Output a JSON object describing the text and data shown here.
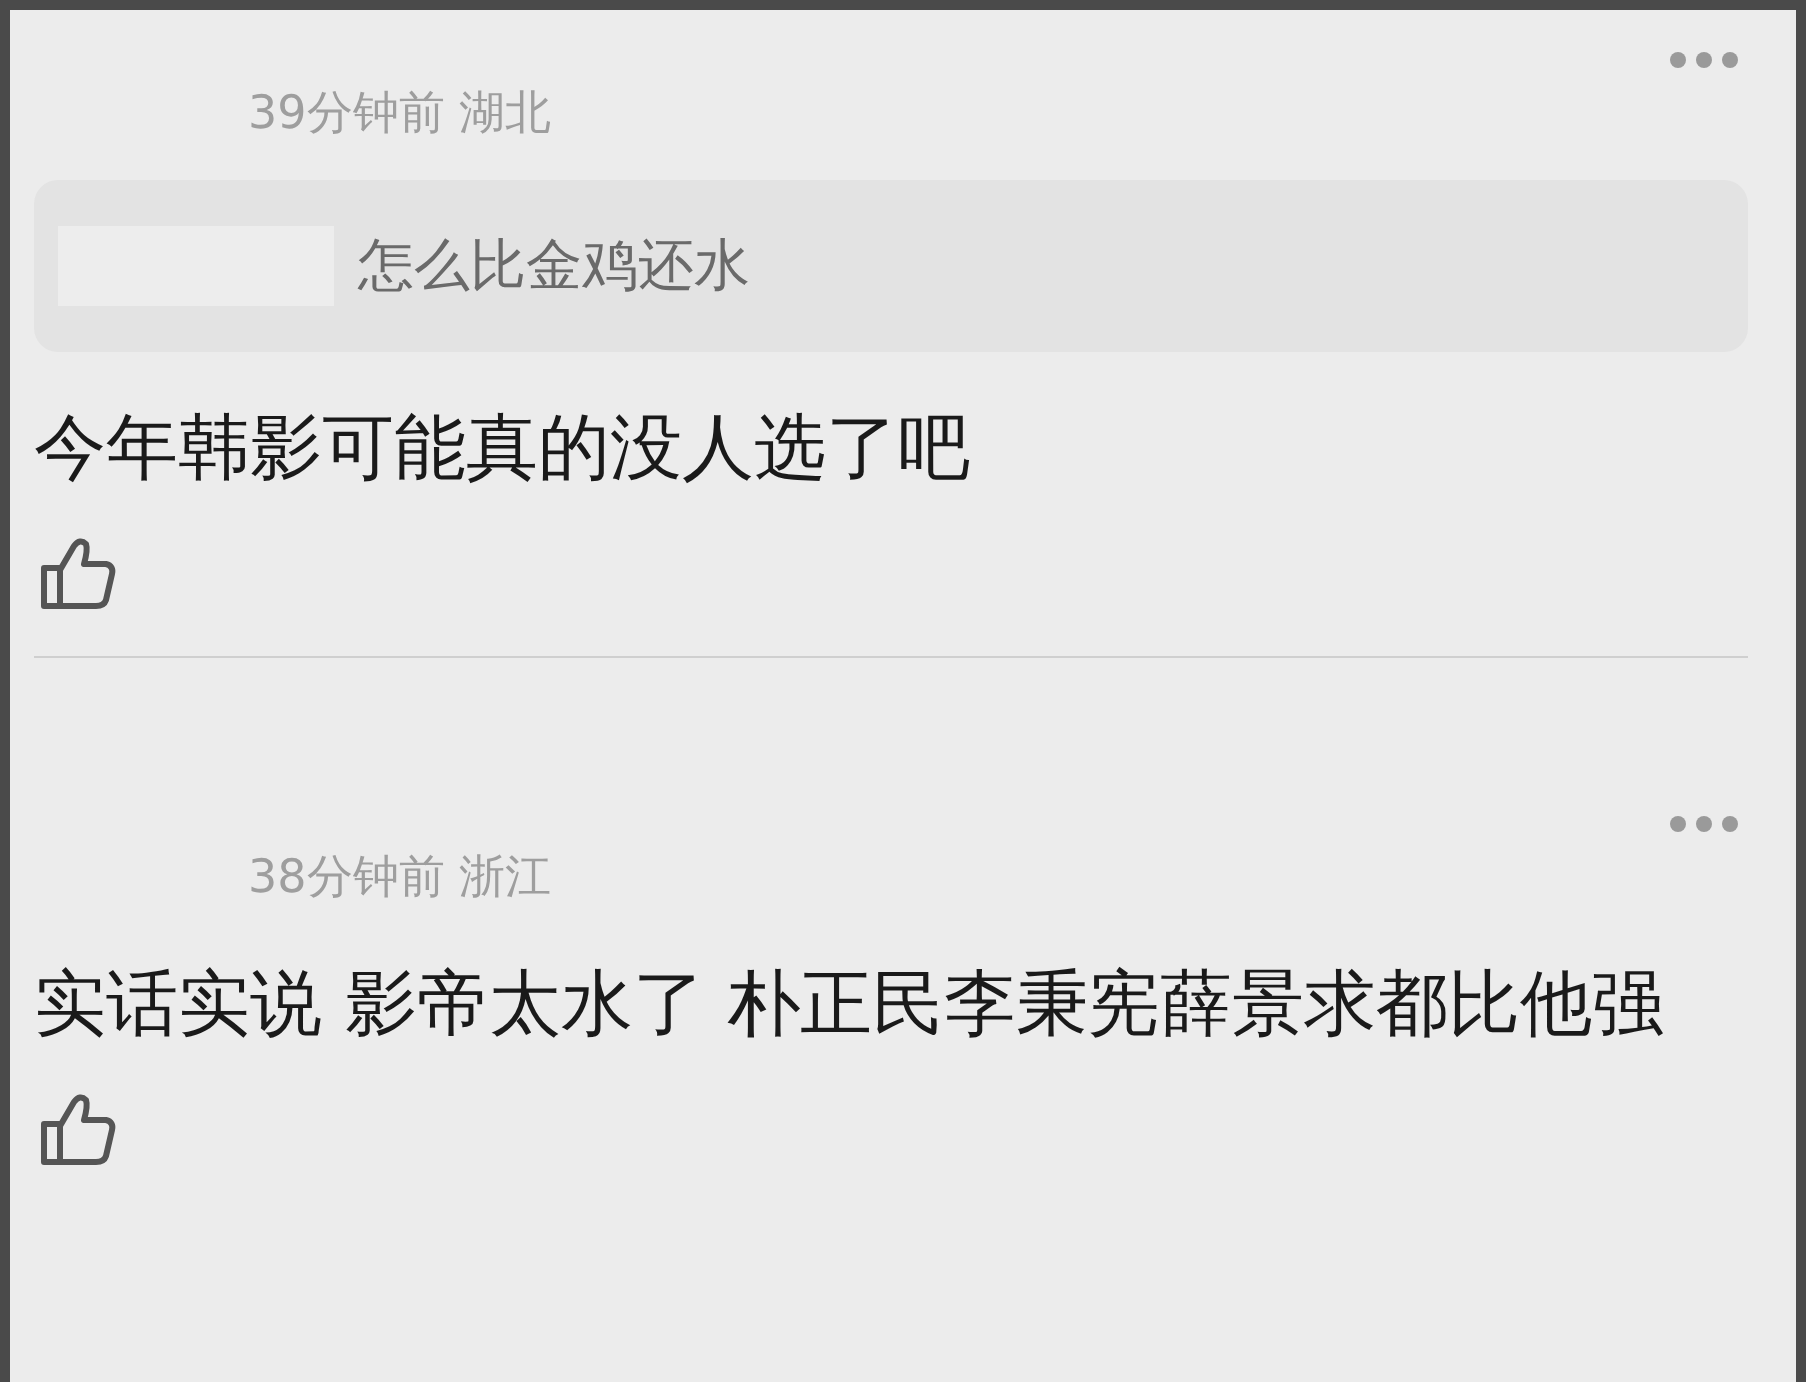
{
  "comments": [
    {
      "time": "39分钟前",
      "location": "湖北",
      "quote": {
        "text": "怎么比金鸡还水"
      },
      "text": "今年韩影可能真的没人选了吧"
    },
    {
      "time": "38分钟前",
      "location": "浙江",
      "text": "实话实说 影帝太水了 朴正民李秉宪薛景求都比他强"
    }
  ]
}
